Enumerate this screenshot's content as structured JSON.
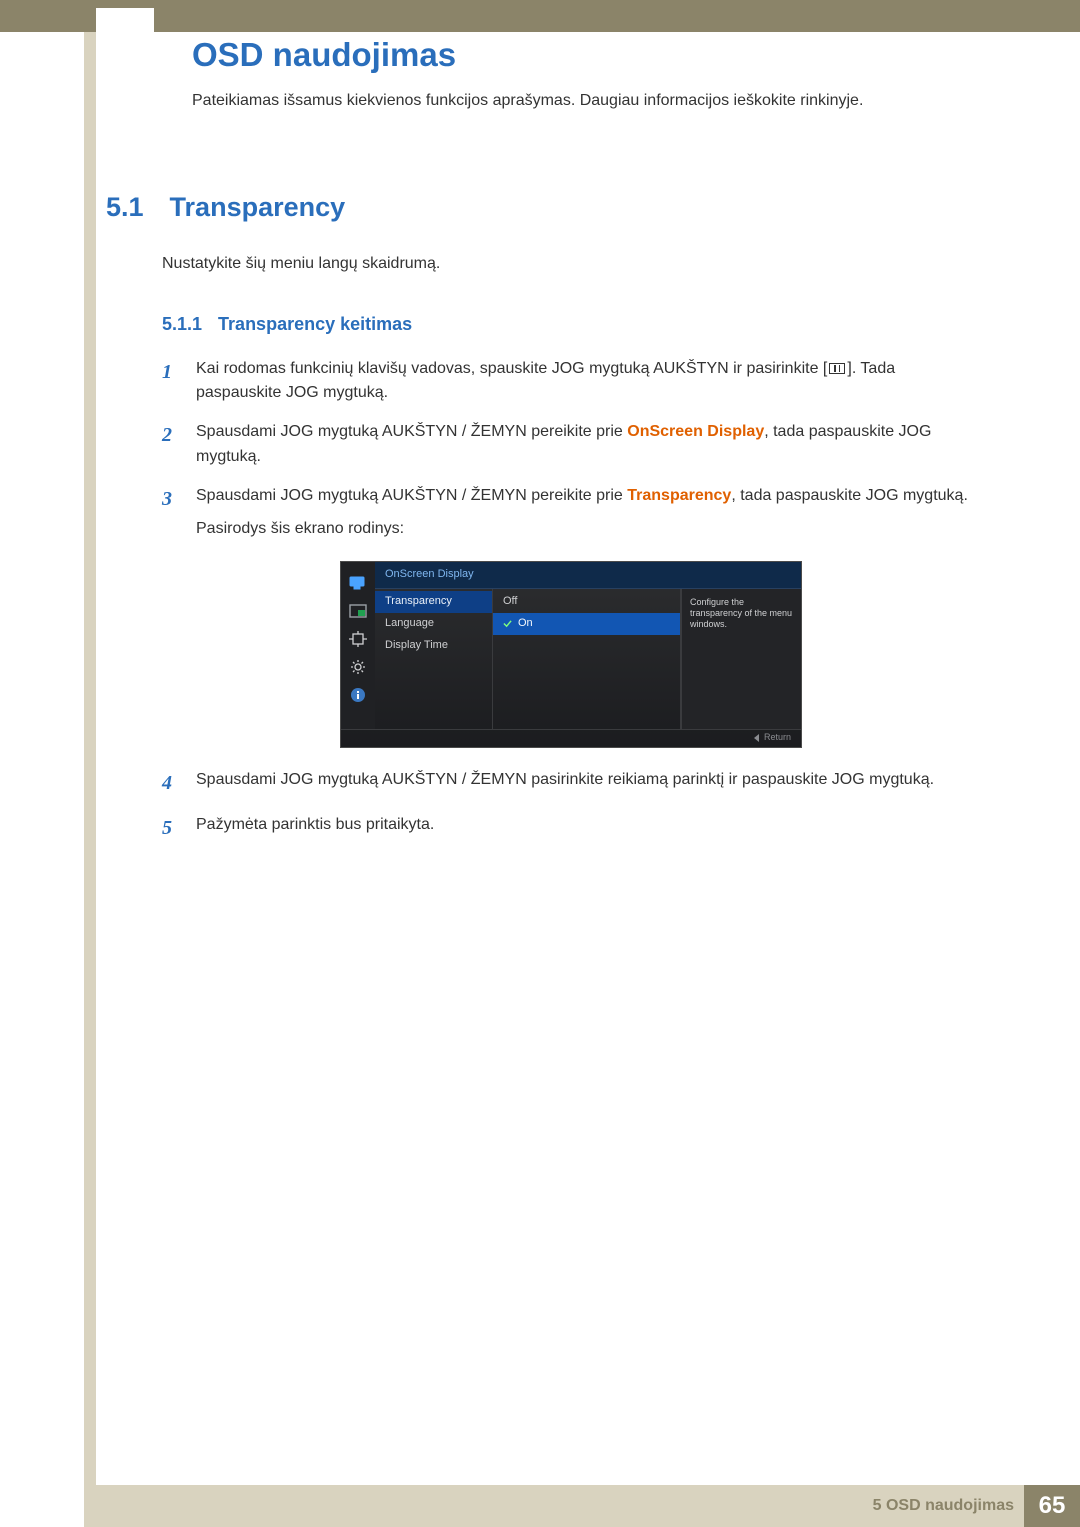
{
  "header": {
    "title": "OSD naudojimas",
    "intro": "Pateikiamas išsamus kiekvienos funkcijos aprašymas. Daugiau informacijos ieškokite rinkinyje."
  },
  "section": {
    "num": "5.1",
    "title": "Transparency",
    "body": "Nustatykite šių meniu langų skaidrumą."
  },
  "subsection": {
    "num": "5.1.1",
    "title": "Transparency keitimas"
  },
  "steps": {
    "s1": {
      "num": "1",
      "t1": "Kai rodomas funkcinių klavišų vadovas, spauskite JOG mygtuką AUKŠTYN ir pasirinkite [",
      "t2": "]. Tada paspauskite JOG mygtuką."
    },
    "s2": {
      "num": "2",
      "pre": "Spausdami JOG mygtuką AUKŠTYN / ŽEMYN pereikite prie ",
      "hl": "OnScreen Display",
      "post": ", tada paspauskite JOG mygtuką."
    },
    "s3": {
      "num": "3",
      "pre": "Spausdami JOG mygtuką AUKŠTYN / ŽEMYN pereikite prie ",
      "hl": "Transparency",
      "post": ", tada paspauskite JOG mygtuką.",
      "after": "Pasirodys šis ekrano rodinys:"
    },
    "s4": {
      "num": "4",
      "text": "Spausdami JOG mygtuką AUKŠTYN / ŽEMYN pasirinkite reikiamą parinktį ir paspauskite JOG mygtuką."
    },
    "s5": {
      "num": "5",
      "text": "Pažymėta parinktis bus pritaikyta."
    }
  },
  "osd": {
    "header": "OnScreen Display",
    "left": {
      "transparency": "Transparency",
      "language": "Language",
      "displaytime": "Display Time"
    },
    "right": {
      "off": "Off",
      "on": "On"
    },
    "tooltip": "Configure the transparency of the menu windows.",
    "return": "Return"
  },
  "footer": {
    "label": "5 OSD naudojimas",
    "page": "65"
  }
}
